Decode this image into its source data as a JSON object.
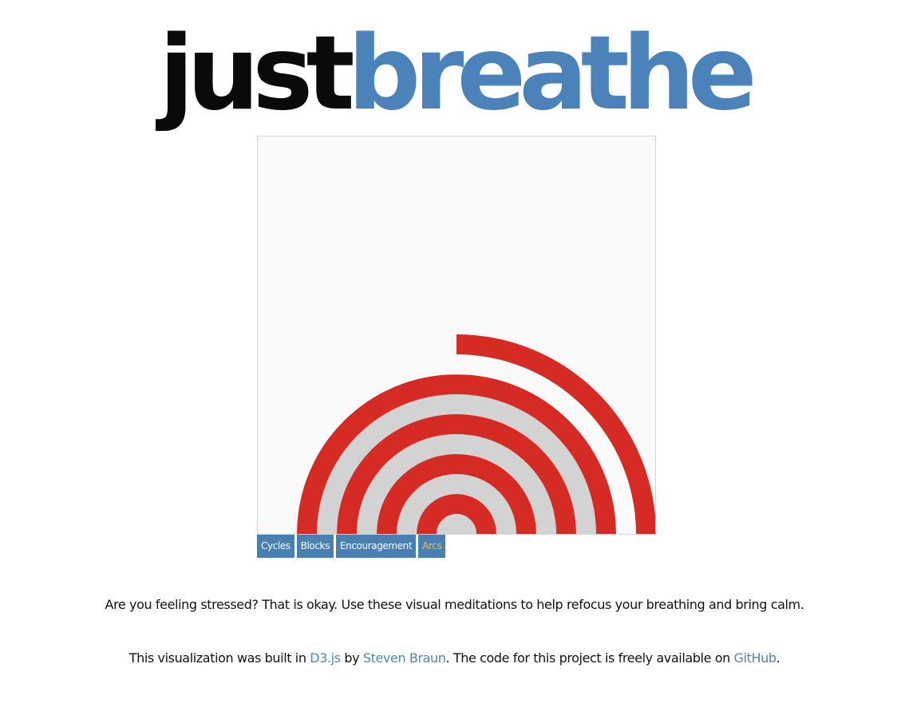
{
  "logo": {
    "part1": "just",
    "part2": "breathe"
  },
  "visualization": {
    "mode": "Arcs",
    "colors": {
      "arc": "#d62a24",
      "track": "#d3d3d3",
      "background": "#fafafa"
    },
    "arc_progress": [
      1.0,
      1.0,
      1.0,
      1.0,
      0.5
    ]
  },
  "tabs": [
    {
      "label": "Cycles",
      "active": false
    },
    {
      "label": "Blocks",
      "active": false
    },
    {
      "label": "Encouragement",
      "active": false
    },
    {
      "label": "Arcs",
      "active": true
    }
  ],
  "intro": {
    "text": "Are you feeling stressed? That is okay. Use these visual meditations to help refocus your breathing and bring calm."
  },
  "credits": {
    "prefix": "This visualization was built in ",
    "d3_link": "D3.js",
    "by": " by ",
    "author_link": "Steven Braun",
    "middle": ". The code for this project is freely available on ",
    "github_link": "GitHub",
    "suffix": "."
  }
}
